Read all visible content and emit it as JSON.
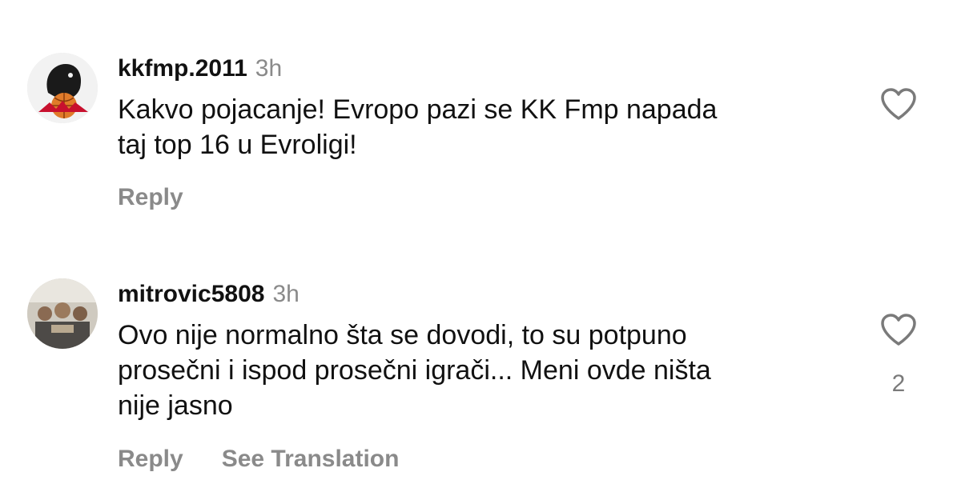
{
  "comments": [
    {
      "username": "kkfmp.2011",
      "time": "3h",
      "lines": [
        "Kakvo pojacanje! Evropo pazi se KK Fmp napada",
        "taj top 16 u Evroligi!"
      ],
      "reply_label": "Reply",
      "like_icon": "heart-outline-icon",
      "like_count": ""
    },
    {
      "username": "mitrovic5808",
      "time": "3h",
      "lines": [
        "Ovo nije normalno šta se dovodi, to su potpuno",
        "prosečni i ispod prosečni igrači... Meni ovde ništa",
        "nije jasno"
      ],
      "reply_label": "Reply",
      "translate_label": "See Translation",
      "like_icon": "heart-outline-icon",
      "like_count": "2"
    }
  ],
  "colors": {
    "text": "#111111",
    "secondary": "#8a8a8a",
    "brand_red": "#c8102e"
  }
}
